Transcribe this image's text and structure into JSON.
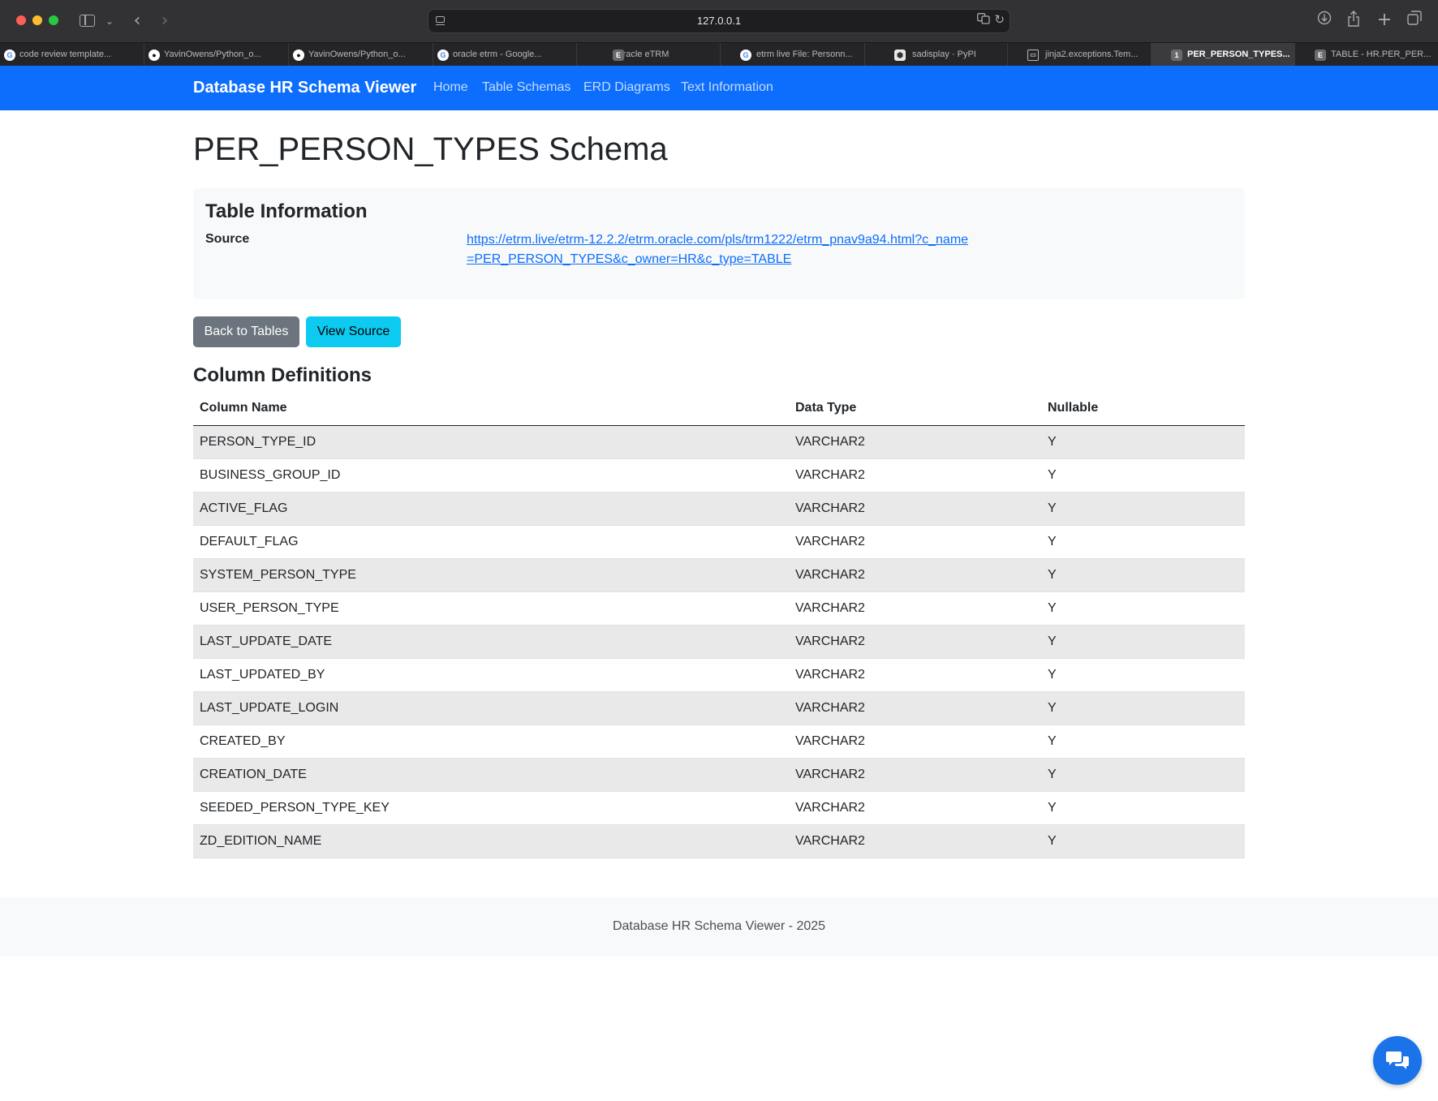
{
  "browser": {
    "address": "127.0.0.1",
    "tabs": [
      {
        "label": "code review template...",
        "icon": "google-icon"
      },
      {
        "label": "YavinOwens/Python_o...",
        "icon": "github-icon"
      },
      {
        "label": "YavinOwens/Python_o...",
        "icon": "github-icon"
      },
      {
        "label": "oracle etrm - Google...",
        "icon": "google-icon"
      },
      {
        "label": "Oracle eTRM",
        "icon": "etrm-icon"
      },
      {
        "label": "etrm live File: Personn...",
        "icon": "google-icon"
      },
      {
        "label": "sadisplay · PyPI",
        "icon": "pypi-icon"
      },
      {
        "label": "jinja2.exceptions.Tem...",
        "icon": "terminal-icon"
      },
      {
        "label": "PER_PERSON_TYPES...",
        "icon": "local-app-icon",
        "active": true
      },
      {
        "label": "TABLE - HR.PER_PER...",
        "icon": "etrm-icon"
      }
    ]
  },
  "navbar": {
    "brand": "Database HR Schema Viewer",
    "links": [
      "Home",
      "Table Schemas",
      "ERD Diagrams",
      "Text Information"
    ]
  },
  "page": {
    "title": "PER_PERSON_TYPES Schema",
    "info": {
      "heading": "Table Information",
      "source_label": "Source",
      "source_url": "https://etrm.live/etrm-12.2.2/etrm.oracle.com/pls/trm1222/etrm_pnav9a94.html?c_name=PER_PERSON_TYPES&c_owner=HR&c_type=TABLE"
    },
    "buttons": {
      "back": "Back to Tables",
      "view_source": "View Source"
    },
    "columns_heading": "Column Definitions",
    "table": {
      "headers": [
        "Column Name",
        "Data Type",
        "Nullable"
      ],
      "rows": [
        [
          "PERSON_TYPE_ID",
          "VARCHAR2",
          "Y"
        ],
        [
          "BUSINESS_GROUP_ID",
          "VARCHAR2",
          "Y"
        ],
        [
          "ACTIVE_FLAG",
          "VARCHAR2",
          "Y"
        ],
        [
          "DEFAULT_FLAG",
          "VARCHAR2",
          "Y"
        ],
        [
          "SYSTEM_PERSON_TYPE",
          "VARCHAR2",
          "Y"
        ],
        [
          "USER_PERSON_TYPE",
          "VARCHAR2",
          "Y"
        ],
        [
          "LAST_UPDATE_DATE",
          "VARCHAR2",
          "Y"
        ],
        [
          "LAST_UPDATED_BY",
          "VARCHAR2",
          "Y"
        ],
        [
          "LAST_UPDATE_LOGIN",
          "VARCHAR2",
          "Y"
        ],
        [
          "CREATED_BY",
          "VARCHAR2",
          "Y"
        ],
        [
          "CREATION_DATE",
          "VARCHAR2",
          "Y"
        ],
        [
          "SEEDED_PERSON_TYPE_KEY",
          "VARCHAR2",
          "Y"
        ],
        [
          "ZD_EDITION_NAME",
          "VARCHAR2",
          "Y"
        ]
      ]
    }
  },
  "footer": {
    "text": "Database HR Schema Viewer - 2025"
  },
  "colors": {
    "navbar": "#0d6efd",
    "back_button": "#6c757d",
    "view_button": "#0dcaf0",
    "chat_button": "#1a73e8"
  }
}
